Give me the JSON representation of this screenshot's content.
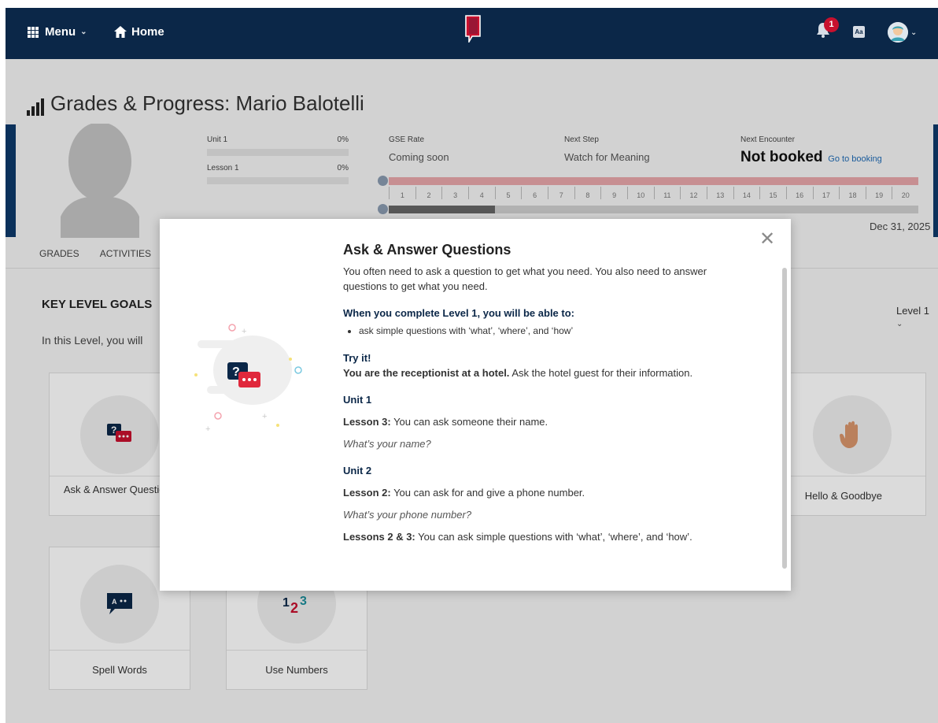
{
  "nav": {
    "menu_label": "Menu",
    "home_label": "Home",
    "notification_count": "1",
    "aa_label": "Aa"
  },
  "page": {
    "title": "Grades & Progress: Mario Balotelli"
  },
  "progress": {
    "unit_label": "Unit 1",
    "unit_pct": "0%",
    "lesson_label": "Lesson 1",
    "lesson_pct": "0%"
  },
  "stats": {
    "gse_label": "GSE Rate",
    "gse_value": "Coming soon",
    "next_step_label": "Next Step",
    "next_step_value": "Watch for Meaning",
    "next_encounter_label": "Next Encounter",
    "next_encounter_value": "Not booked",
    "booking_link": "Go to booking"
  },
  "scale": {
    "ticks": [
      "1",
      "2",
      "3",
      "4",
      "5",
      "6",
      "7",
      "8",
      "9",
      "10",
      "11",
      "12",
      "13",
      "14",
      "15",
      "16",
      "17",
      "18",
      "19",
      "20"
    ],
    "completed_fraction": 0.2
  },
  "date": "Dec 31, 2025",
  "tabs": [
    "GRADES",
    "ACTIVITIES"
  ],
  "goals": {
    "heading": "KEY LEVEL GOALS",
    "intro": "In this Level, you will",
    "level_select": "Level 1",
    "cards": [
      {
        "label": "Ask & Answer Questions"
      },
      {
        "label": "Hello & Goodbye"
      },
      {
        "label": "Spell Words"
      },
      {
        "label": "Use Numbers"
      }
    ]
  },
  "modal": {
    "title": "Ask & Answer Questions",
    "intro": "You often need to ask a question to get what you need. You also need to answer questions to get what you need.",
    "complete_heading": "When you complete Level 1, you will be able to:",
    "bullet": "ask simple questions with ‘what’, ‘where’, and ‘how’",
    "try_heading": "Try it!",
    "try_bold": "You are the receptionist at a hotel.",
    "try_rest": " Ask the hotel guest for their information.",
    "unit1_heading": "Unit 1",
    "unit1_lesson_bold": "Lesson 3:",
    "unit1_lesson_text": " You can ask someone their name.",
    "unit1_example": "What’s your name?",
    "unit2_heading": "Unit 2",
    "unit2_lesson_bold": "Lesson 2:",
    "unit2_lesson_text": " You can ask for and give a phone number.",
    "unit2_example": "What’s your phone number?",
    "unit2_lessons_bold": "Lessons 2 & 3:",
    "unit2_lessons_text": " You can ask simple questions with ‘what’, ‘where’, and ‘how’."
  },
  "colors": {
    "nav_bg": "#0b2748",
    "accent_red": "#c8102e",
    "link_blue": "#1f6bb5",
    "scale_pink": "#e8a7ab"
  },
  "icons": [
    "grid-icon",
    "home-icon",
    "logo-icon",
    "bell-icon",
    "avatar-icon",
    "chart-bars-icon",
    "chat-question-icon",
    "waving-hand-icon",
    "spell-bubble-icon",
    "numbers-icon",
    "close-icon"
  ]
}
